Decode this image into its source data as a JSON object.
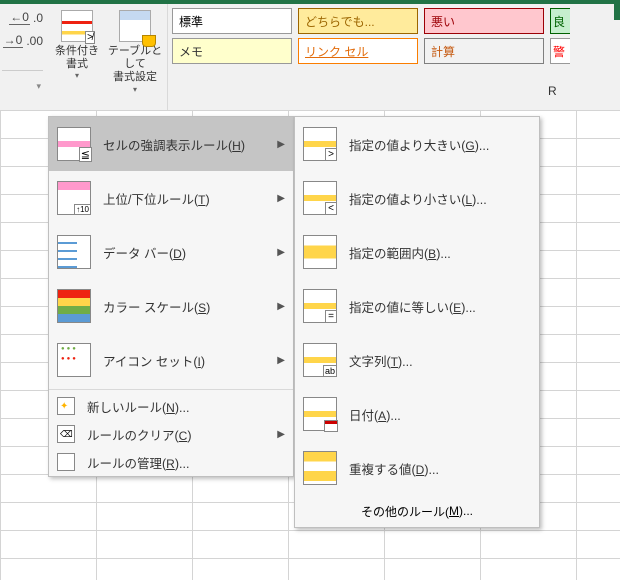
{
  "ribbon": {
    "number_format_tip": ".0",
    "number_format_tip2": ".00",
    "cond_format": "条件付き\n書式",
    "table_format": "テーブルとして\n書式設定",
    "dropdown_glyph": "▾"
  },
  "styles": {
    "row1": [
      "標準",
      "どちらでも...",
      "悪い",
      "良"
    ],
    "row2": [
      "メモ",
      "リンク セル",
      "計算",
      "警"
    ]
  },
  "column_letter": "R",
  "main_menu": [
    {
      "key": "highlight",
      "label_pre": "セルの強調表示ルール(",
      "accel": "H",
      "label_post": ")",
      "arrow": true,
      "hover": true
    },
    {
      "key": "top",
      "label_pre": "上位/下位ルール(",
      "accel": "T",
      "label_post": ")",
      "arrow": true
    },
    {
      "key": "databar",
      "label_pre": "データ バー(",
      "accel": "D",
      "label_post": ")",
      "arrow": true
    },
    {
      "key": "scale",
      "label_pre": "カラー スケール(",
      "accel": "S",
      "label_post": ")",
      "arrow": true
    },
    {
      "key": "iconset",
      "label_pre": "アイコン セット(",
      "accel": "I",
      "label_post": ")",
      "arrow": true
    },
    {
      "sep": true
    },
    {
      "key": "new",
      "small": true,
      "label_pre": "新しいルール(",
      "accel": "N",
      "label_post": ")..."
    },
    {
      "key": "clear",
      "small": true,
      "label_pre": "ルールのクリア(",
      "accel": "C",
      "label_post": ")",
      "arrow": true
    },
    {
      "key": "manage",
      "small": true,
      "label_pre": "ルールの管理(",
      "accel": "R",
      "label_post": ")..."
    }
  ],
  "sub_menu": [
    {
      "key": "gt",
      "label_pre": "指定の値より大きい(",
      "accel": "G",
      "label_post": ")..."
    },
    {
      "key": "lt",
      "label_pre": "指定の値より小さい(",
      "accel": "L",
      "label_post": ")..."
    },
    {
      "key": "between",
      "label_pre": "指定の範囲内(",
      "accel": "B",
      "label_post": ")..."
    },
    {
      "key": "equal",
      "label_pre": "指定の値に等しい(",
      "accel": "E",
      "label_post": ")..."
    },
    {
      "key": "text",
      "label_pre": "文字列(",
      "accel": "T",
      "label_post": ")..."
    },
    {
      "key": "date",
      "label_pre": "日付(",
      "accel": "A",
      "label_post": ")..."
    },
    {
      "key": "dup",
      "label_pre": "重複する値(",
      "accel": "D",
      "label_post": ")..."
    }
  ],
  "more_rules": {
    "label_pre": "その他のルール(",
    "accel": "M",
    "label_post": ")..."
  }
}
